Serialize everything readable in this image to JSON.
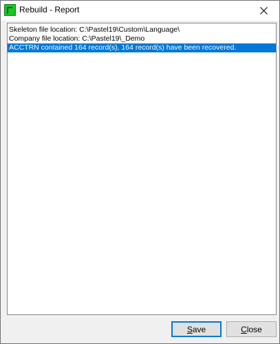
{
  "window": {
    "title": "Rebuild - Report"
  },
  "report": {
    "lines": [
      "Skeleton file location: C:\\Pastel19\\Custom\\Language\\",
      "Company file location: C:\\Pastel19\\_Demo",
      "ACCTRN contained 164 record(s), 164 record(s) have been recovered."
    ],
    "selected_index": 2
  },
  "buttons": {
    "save_mnemonic": "S",
    "save_rest": "ave",
    "close_mnemonic": "C",
    "close_rest": "lose"
  },
  "colors": {
    "selection": "#0078d7",
    "app_icon": "#1fc12a"
  },
  "icons": {
    "app": "pastel-app-icon",
    "close": "close-x-icon"
  }
}
